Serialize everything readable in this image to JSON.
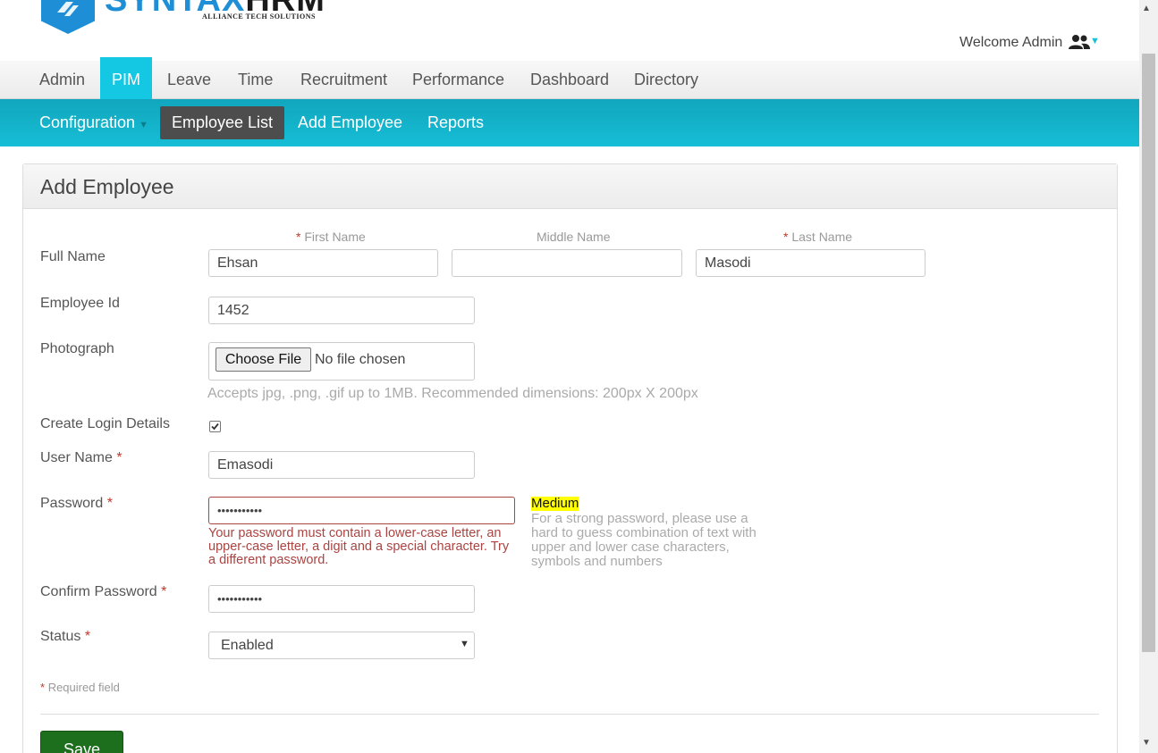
{
  "brand": {
    "name_part1": "SYNTAX",
    "name_part2": "HRM",
    "tagline": "ALLIANCE TECH SOLUTIONS"
  },
  "header": {
    "welcome": "Welcome Admin"
  },
  "main_nav": {
    "items": [
      {
        "label": "Admin"
      },
      {
        "label": "PIM",
        "active": true
      },
      {
        "label": "Leave"
      },
      {
        "label": "Time"
      },
      {
        "label": "Recruitment"
      },
      {
        "label": "Performance"
      },
      {
        "label": "Dashboard"
      },
      {
        "label": "Directory"
      }
    ]
  },
  "sub_nav": {
    "items": [
      {
        "label": "Configuration",
        "has_dropdown": true
      },
      {
        "label": "Employee List",
        "active": true
      },
      {
        "label": "Add Employee"
      },
      {
        "label": "Reports"
      }
    ]
  },
  "form": {
    "title": "Add Employee",
    "full_name": {
      "label": "Full Name",
      "first_label": "First Name",
      "middle_label": "Middle Name",
      "last_label": "Last Name",
      "first_value": "Ehsan",
      "middle_value": "",
      "last_value": "Masodi"
    },
    "employee_id": {
      "label": "Employee Id",
      "value": "1452"
    },
    "photograph": {
      "label": "Photograph",
      "button": "Choose File",
      "status": "No file chosen",
      "hint": "Accepts jpg, .png, .gif up to 1MB. Recommended dimensions: 200px X 200px"
    },
    "create_login": {
      "label": "Create Login Details",
      "checked": true
    },
    "user_name": {
      "label": "User Name",
      "value": "Emasodi"
    },
    "password": {
      "label": "Password",
      "value": "•••••••••••",
      "error": "Your password must contain a lower-case letter, an upper-case letter, a digit and a special character. Try a different password.",
      "strength": "Medium",
      "strength_help": "For a strong password, please use a hard to guess combination of text with upper and lower case characters, symbols and numbers"
    },
    "confirm_password": {
      "label": "Confirm Password",
      "value": "•••••••••••"
    },
    "status": {
      "label": "Status",
      "value": "Enabled"
    },
    "required_note": "Required field",
    "required_marker": "*",
    "save_label": "Save"
  },
  "colors": {
    "accent": "#14c7e3",
    "subnav": "#16bed6",
    "save": "#1d6f1d",
    "error": "#a94442",
    "brand_blue": "#1e8fd6"
  }
}
